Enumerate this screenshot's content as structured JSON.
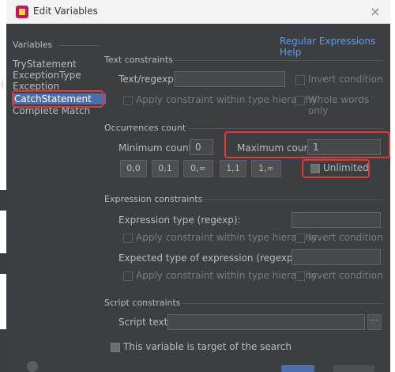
{
  "window": {
    "title": "Edit Variables",
    "close_glyph": "×"
  },
  "sidebar": {
    "heading": "Variables",
    "items": [
      {
        "label": "TryStatement"
      },
      {
        "label": "ExceptionType"
      },
      {
        "label": "Exception"
      },
      {
        "label": "CatchStatement",
        "selected": true
      },
      {
        "label": "Complete Match"
      }
    ]
  },
  "help_link": "Regular Expressions Help",
  "text_constraints": {
    "heading": "Text constraints",
    "regexp_label": "Text/regexp:",
    "regexp_value": "",
    "invert_label": "Invert condition",
    "apply_hierarchy_label": "Apply constraint within type hierarchy",
    "whole_words_label": "Whole words only"
  },
  "occurrences": {
    "heading": "Occurrences count",
    "min_label": "Minimum count:",
    "min_value": "0",
    "max_label": "Maximum count:",
    "max_value": "1",
    "unlimited_label": "Unlimited",
    "unlimited_checked": true,
    "presets": [
      "0,0",
      "0,1",
      "0,∞",
      "1,1",
      "1,∞"
    ]
  },
  "expression_constraints": {
    "heading": "Expression constraints",
    "type_label": "Expression type (regexp):",
    "type_value": "",
    "apply_hierarchy_label_1": "Apply constraint within type hierarchy",
    "invert_label_1": "Invert condition",
    "expected_label": "Expected type of expression (regexp):",
    "expected_value": "",
    "apply_hierarchy_label_2": "Apply constraint within type hierarchy",
    "invert_label_2": "Invert condition"
  },
  "script_constraints": {
    "heading": "Script constraints",
    "script_label": "Script text:",
    "script_value": "",
    "browse_label": "···"
  },
  "target_label": "This variable is target of the search",
  "colors": {
    "dialog_bg": "#3c3f41",
    "text": "#bbbbbb",
    "link": "#589df6",
    "selection": "#4b6eaf",
    "annotation_red": "#e53935"
  }
}
